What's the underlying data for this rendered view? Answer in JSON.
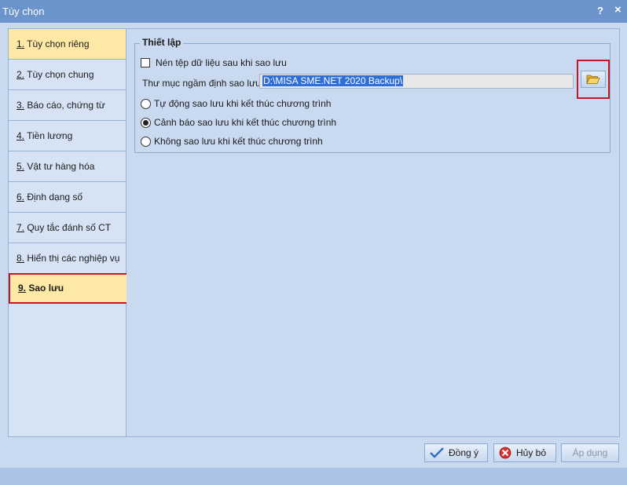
{
  "window": {
    "title": "Tùy chọn",
    "help_label": "?",
    "close_label": "×"
  },
  "sidebar": {
    "items": [
      {
        "num": "1.",
        "label": " Tùy chọn riêng"
      },
      {
        "num": "2.",
        "label": " Tùy chọn chung"
      },
      {
        "num": "3.",
        "label": " Báo cáo, chứng từ"
      },
      {
        "num": "4.",
        "label": " Tiền lương"
      },
      {
        "num": "5.",
        "label": " Vật tư hàng hóa"
      },
      {
        "num": "6.",
        "label": " Định dạng số"
      },
      {
        "num": "7.",
        "label": " Quy tắc đánh số CT"
      },
      {
        "num": "8.",
        "label": " Hiển thị các nghiệp vụ"
      },
      {
        "num": "9.",
        "label": " Sao lưu"
      }
    ],
    "selected": "9. Sao lưu"
  },
  "settings": {
    "group_title": "Thiết lập",
    "compress_label": "Nén tệp dữ liệu sau khi sao lưu",
    "compress_checked": false,
    "folder_label": "Thư mục ngầm định sao lưu",
    "folder_value": "D:\\MISA SME.NET 2020 Backup\\",
    "radio_options": [
      {
        "label": "Tự động sao lưu khi kết thúc chương trình",
        "selected": false
      },
      {
        "label": "Cảnh báo sao lưu khi kết thúc chương trình",
        "selected": true
      },
      {
        "label": "Không sao lưu khi kết thúc chương trình",
        "selected": false
      }
    ]
  },
  "footer": {
    "ok_label": "Đồng ý",
    "cancel_label": "Hủy bỏ",
    "apply_label": "Áp dụng"
  },
  "colors": {
    "titlebar": "#6b93cc",
    "highlight": "#c0172b",
    "selected_item": "#fde9a5",
    "text_selection": "#2e6fd6"
  },
  "icons": {
    "browse": "folder-open-icon",
    "ok": "check-icon",
    "cancel": "cancel-icon"
  }
}
